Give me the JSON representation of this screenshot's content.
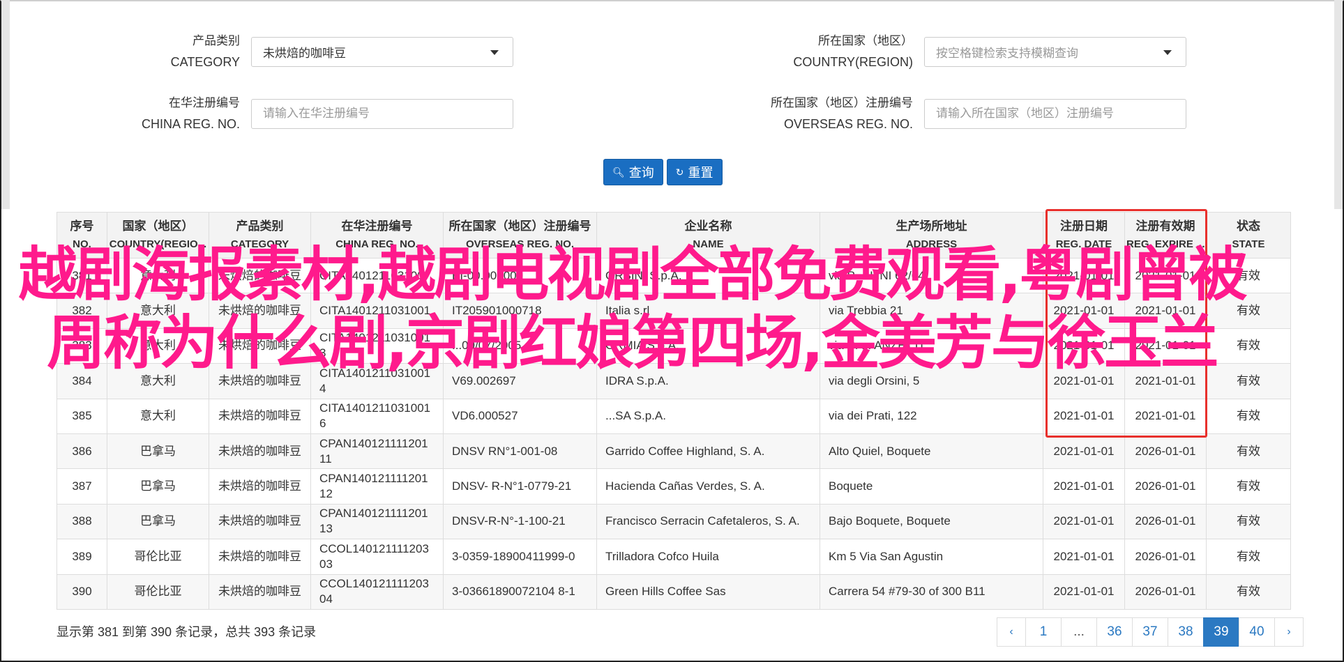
{
  "form": {
    "category_label_cn": "产品类别",
    "category_label_en": "CATEGORY",
    "category_value": "未烘焙的咖啡豆",
    "country_label_cn": "所在国家（地区）",
    "country_label_en": "COUNTRY(REGION)",
    "country_placeholder": "按空格键检索支持模糊查询",
    "china_reg_label_cn": "在华注册编号",
    "china_reg_label_en": "CHINA REG. NO.",
    "china_reg_placeholder": "请输入在华注册编号",
    "overseas_reg_label_cn": "所在国家（地区）注册编号",
    "overseas_reg_label_en": "OVERSEAS REG. NO.",
    "overseas_reg_placeholder": "请输入所在国家（地区）注册编号",
    "query_button": "查询",
    "reset_button": "重置"
  },
  "table": {
    "headers": [
      {
        "cn": "序号",
        "en": "NO."
      },
      {
        "cn": "国家（地区）",
        "en": "COUNTRY(REGIO..."
      },
      {
        "cn": "产品类别",
        "en": "CATEGORY"
      },
      {
        "cn": "在华注册编号",
        "en": "CHINA REG. NO."
      },
      {
        "cn": "所在国家（地区）注册编号",
        "en": "OVERSEAS REG. NO."
      },
      {
        "cn": "企业名称",
        "en": "NAME"
      },
      {
        "cn": "生产场所地址",
        "en": "ADDRESS"
      },
      {
        "cn": "注册日期",
        "en": "REG. DATE"
      },
      {
        "cn": "注册有效期",
        "en": "REG. EXPIRE ..."
      },
      {
        "cn": "状态",
        "en": "STATE"
      }
    ],
    "rows": [
      [
        "381",
        "意大利",
        "未烘焙的咖啡豆",
        "CITA140121103100",
        "BI-00.000000",
        "ORSINI S.p.A.",
        "via P. ...LINI 62/64",
        "2021-01-01",
        "2021-01-01",
        "有效"
      ],
      [
        "382",
        "意大利",
        "未烘焙的咖啡豆",
        "CITA1401211031001",
        "IT205901000718",
        "Italia s.rl",
        "via Trebbia 21",
        "2021-01-01",
        "2021-01-01",
        "有效"
      ],
      [
        "383",
        "意大利",
        "未烘焙的咖啡豆",
        "CITA1401211031001 3",
        "...09/07/2005",
        "ORMIA S.p.A.",
        "via S. ... ANZETTI",
        "2021-01-01",
        "2021-01-01",
        "有效"
      ],
      [
        "384",
        "意大利",
        "未烘焙的咖啡豆",
        "CITA1401211031001 4",
        "V69.002697",
        "IDRA S.p.A.",
        "via degli Orsini, 5",
        "2021-01-01",
        "2021-01-01",
        "有效"
      ],
      [
        "385",
        "意大利",
        "未烘焙的咖啡豆",
        "CITA1401211031001 6",
        "VD6.000527",
        "...SA S.p.A.",
        "via dei Prati, 122",
        "2021-01-01",
        "2021-01-01",
        "有效"
      ],
      [
        "386",
        "巴拿马",
        "未烘焙的咖啡豆",
        "CPAN140121111201 11",
        "DNSV RN°1-001-08",
        "Garrido Coffee Highland, S. A.",
        "Alto Quiel, Boquete",
        "2021-01-01",
        "2026-01-01",
        "有效"
      ],
      [
        "387",
        "巴拿马",
        "未烘焙的咖啡豆",
        "CPAN140121111201 12",
        "DNSV- R-N°1-0779-21",
        "Hacienda Cañas Verdes, S. A.",
        "Boquete",
        "2021-01-01",
        "2026-01-01",
        "有效"
      ],
      [
        "388",
        "巴拿马",
        "未烘焙的咖啡豆",
        "CPAN140121111201 13",
        "DNSV-R-N°-1-100-21",
        "Francisco Serracin Cafetaleros, S. A.",
        "Bajo Boquete, Boquete",
        "2021-01-01",
        "2026-01-01",
        "有效"
      ],
      [
        "389",
        "哥伦比亚",
        "未烘焙的咖啡豆",
        "CCOL140121111203 03",
        "3-0359-18900411999-0",
        "Trilladora Cofco Huila",
        "Km 5 Via San Agustin",
        "2021-01-01",
        "2026-01-01",
        "有效"
      ],
      [
        "390",
        "哥伦比亚",
        "未烘焙的咖啡豆",
        "CCOL140121111203 04",
        "3-03661890072104 8-1",
        "Green Hills Coffee Sas",
        "Carrera 54 #79-30 of 300 B11",
        "2021-01-01",
        "2026-01-01",
        "有效"
      ]
    ]
  },
  "footer": {
    "summary": "显示第 381 到第 390 条记录，总共 393 条记录",
    "pages": [
      "‹",
      "1",
      "...",
      "36",
      "37",
      "38",
      "39",
      "40",
      "›"
    ],
    "active_page": "39"
  },
  "overlay_title": "越剧海报素材,越剧电视剧全部免费观看,粤剧曾被周称为什么剧,京剧红娘第四场,金美芳与徐玉兰",
  "colors": {
    "primary_button": "#1a6ec2",
    "overlay_text": "#ff1a8c",
    "highlight_border": "#e8302c",
    "pager_active": "#2b79c2"
  }
}
